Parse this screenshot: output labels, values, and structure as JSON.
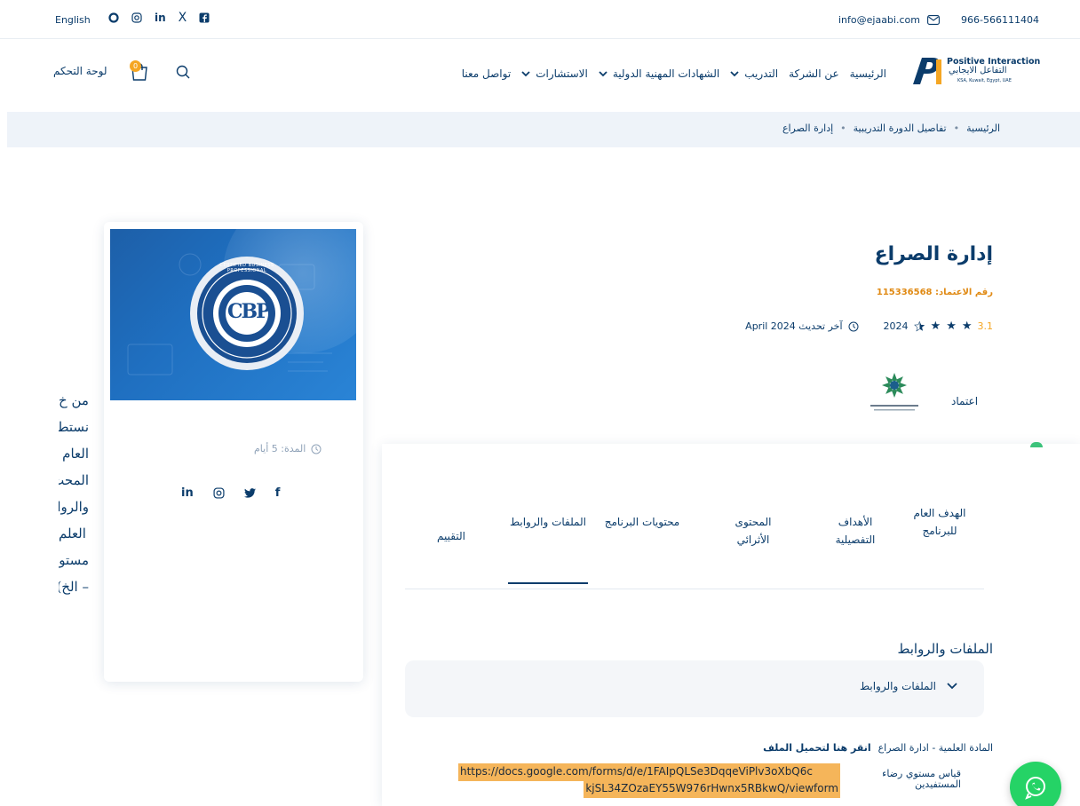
{
  "topbar": {
    "language": "English",
    "social_icons": [
      "circle-icon",
      "instagram-icon",
      "linkedin-icon",
      "x-icon",
      "facebook-icon"
    ],
    "linkedin_text": "in",
    "x_text": "X",
    "email": "info@ejaabi.com",
    "phone": "966-566111404"
  },
  "nav": {
    "logo_en": "Positive Interaction",
    "logo_ar": "التفاعل الايجابي",
    "logo_sub": "KSA, Kuwait, Egypt, UAE",
    "links": [
      {
        "label": "الرئيسية",
        "dropdown": false
      },
      {
        "label": "عن الشركة",
        "dropdown": false
      },
      {
        "label": "التدريب",
        "dropdown": true
      },
      {
        "label": "الشهادات المهنية الدولية",
        "dropdown": true
      },
      {
        "label": "الاستشارات",
        "dropdown": true
      },
      {
        "label": "تواصل معنا",
        "dropdown": false
      }
    ],
    "dashboard": "لوحة التحكم",
    "cart_count": "0"
  },
  "breadcrumb": {
    "items": [
      "الرئيسية",
      "تفاصيل الدورة التدريبية",
      "إدارة الصراع"
    ],
    "separator": "•"
  },
  "course": {
    "title": "إدارة الصراع",
    "accreditation_number": "رقم الاعتماد: 115336568",
    "rating": "3.1",
    "rating_max": 5,
    "rating_count": "2024",
    "updated": "آخر تحديث April 2024",
    "accreditation_label": "اعتماد"
  },
  "sidecard": {
    "banner_text": "CBP",
    "banner_ring_text": "CERTIFIED BUSINESS PROFESSIONAL",
    "duration": "المدة: 5 أيام",
    "social": [
      "linkedin-icon",
      "instagram-icon",
      "twitter-icon",
      "facebook-icon"
    ],
    "linkedin_text": "in",
    "facebook_text": "f"
  },
  "tabs": [
    {
      "label": "الهدف العام للبرنامج",
      "active": false
    },
    {
      "label": "الأهداف التفصيلية",
      "active": false
    },
    {
      "label": "المحتوى الأثرائي",
      "active": false
    },
    {
      "label": "محتويات البرنامج",
      "active": false
    },
    {
      "label": "الملفات والروابط",
      "active": true
    },
    {
      "label": "التقييم",
      "active": false
    }
  ],
  "files": {
    "section_title": "الملفات والروابط",
    "accordion_title": "الملفات والروابط",
    "material_label": "المادة العلمية - ادارة الصراع",
    "material_link": "انقر هنا لتحميل الملف",
    "survey_label": "قياس مستوي رضاء المستفيدين",
    "survey_url_line1": "https://docs.google.com/forms/d/e/1FAIpQLSe3DqqeViPlv3oXbQ6c",
    "survey_url_line2": "kjSL34ZOzaEY55W976rHwnx5RBkwQ/viewform"
  },
  "overlay": {
    "lines": [
      "من خ",
      "نستط",
      "العام –",
      "المحت",
      "والرواب",
      "العلم",
      "مستوى",
      "– الخ)"
    ]
  },
  "colors": {
    "primary": "#0b3c6b",
    "accent_orange": "#e08a14",
    "star": "#0b3c6b",
    "highlight": "#f5b55a",
    "whatsapp": "#25d366",
    "breadcrumb_bg": "#eef3f9"
  }
}
